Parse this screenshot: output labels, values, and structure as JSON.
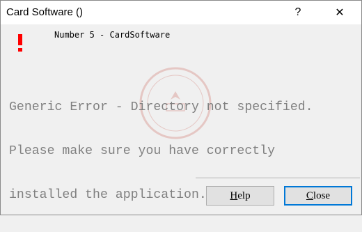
{
  "window": {
    "title": "Card Software ()",
    "help_glyph": "?",
    "close_glyph": "✕"
  },
  "dialog": {
    "icon": "error-exclamation-icon",
    "error_code": "Number 5 - CardSoftware",
    "message_lines": [
      "Generic Error - Directory not specified.",
      "Please make sure you have correctly",
      "installed the application."
    ]
  },
  "buttons": {
    "help_accel": "H",
    "help_rest": "elp",
    "close_accel": "C",
    "close_rest": "lose"
  },
  "colors": {
    "error_red": "#ff0000",
    "focus_blue": "#0078d7",
    "message_gray": "#808080"
  }
}
